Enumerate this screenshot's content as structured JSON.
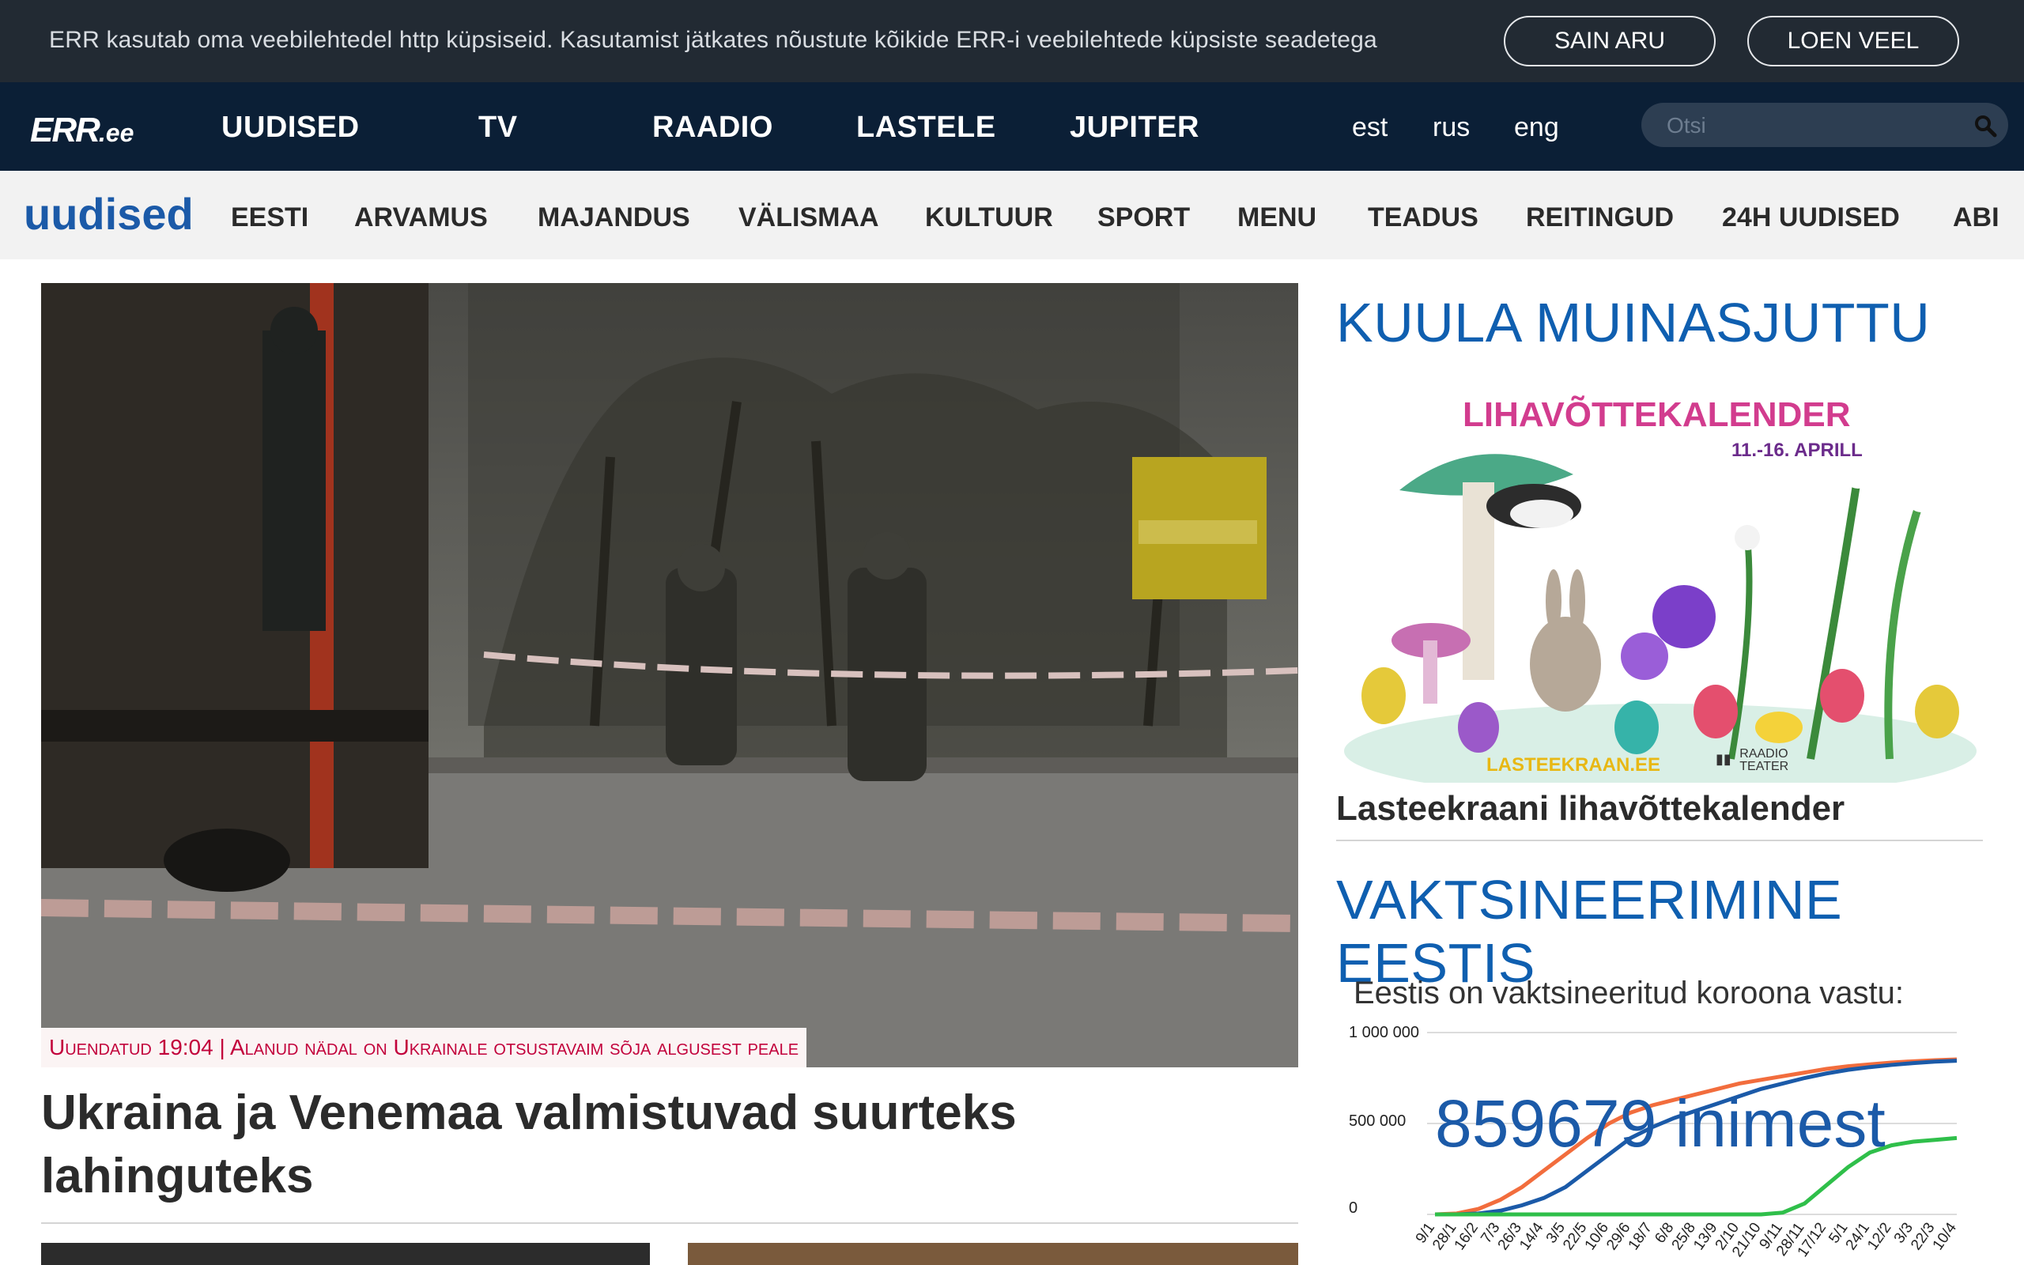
{
  "cookie_bar": {
    "text": "ERR kasutab oma veebilehtedel http küpsiseid. Kasutamist jätkates nõustute kõikide ERR-i veebilehtede küpsiste seadetega",
    "accept_label": "SAIN ARU",
    "more_label": "LOEN VEEL"
  },
  "header": {
    "logo_main": "ERR",
    "logo_suffix": ".ee",
    "nav": [
      "UUDISED",
      "TV",
      "RAADIO",
      "LASTELE",
      "JUPITER"
    ],
    "languages": [
      "est",
      "rus",
      "eng"
    ],
    "search_placeholder": "Otsi"
  },
  "subnav": {
    "brand": "uudised",
    "items": [
      "EESTI",
      "ARVAMUS",
      "MAJANDUS",
      "VÄLISMAA",
      "KULTUUR",
      "SPORT",
      "MENU",
      "TEADUS",
      "REITINGUD",
      "24H UUDISED",
      "ABI"
    ]
  },
  "hero": {
    "tag": "Uuendatud 19:04 | Alanud nädal on Ukrainale otsustavaim sõja algusest peale",
    "headline": "Ukraina ja Venemaa valmistuvad suurteks lahinguteks"
  },
  "sidebar": {
    "fairy_title": "KUULA MUINASJUTTU",
    "promo": {
      "title": "LIHAVÕTTEKALENDER",
      "dates": "11.-16. APRILL",
      "site": "LASTEEKRAAN.EE",
      "partner_top": "RAADIO",
      "partner_bottom": "TEATER",
      "caption": "Lasteekraani lihavõttekalender"
    },
    "vax_title": "VAKTSINEERIMINE EESTIS",
    "vax_label": "Eestis on vaktsineeritud koroona vastu:",
    "vax_count": "859679 inimest"
  },
  "chart_data": {
    "type": "line",
    "title": "Eestis on vaktsineeritud koroona vastu:",
    "y_ticks": [
      "1 000 000",
      "500 000",
      "0"
    ],
    "ylim": [
      0,
      1000000
    ],
    "categories": [
      "9/1",
      "28/1",
      "16/2",
      "7/3",
      "26/3",
      "14/4",
      "3/5",
      "22/5",
      "10/6",
      "29/6",
      "18/7",
      "6/8",
      "25/8",
      "13/9",
      "2/10",
      "21/10",
      "9/11",
      "28/11",
      "17/12",
      "5/1",
      "24/1",
      "12/2",
      "3/3",
      "22/3",
      "10/4"
    ],
    "series": [
      {
        "color": "#f26d3d",
        "values": [
          0,
          5000,
          30000,
          80000,
          150000,
          240000,
          330000,
          420000,
          500000,
          560000,
          600000,
          630000,
          660000,
          690000,
          720000,
          740000,
          760000,
          780000,
          800000,
          815000,
          825000,
          835000,
          842000,
          848000,
          852000
        ]
      },
      {
        "color": "#1b5aa8",
        "values": [
          0,
          0,
          5000,
          20000,
          50000,
          90000,
          150000,
          240000,
          330000,
          420000,
          480000,
          530000,
          570000,
          610000,
          650000,
          690000,
          720000,
          750000,
          775000,
          795000,
          810000,
          822000,
          832000,
          840000,
          845000
        ]
      },
      {
        "color": "#2fbf4a",
        "values": [
          0,
          0,
          0,
          0,
          0,
          0,
          0,
          0,
          0,
          0,
          0,
          0,
          0,
          0,
          0,
          0,
          10000,
          60000,
          160000,
          260000,
          340000,
          380000,
          400000,
          410000,
          420000
        ]
      }
    ],
    "annotation": "859679 inimest"
  }
}
